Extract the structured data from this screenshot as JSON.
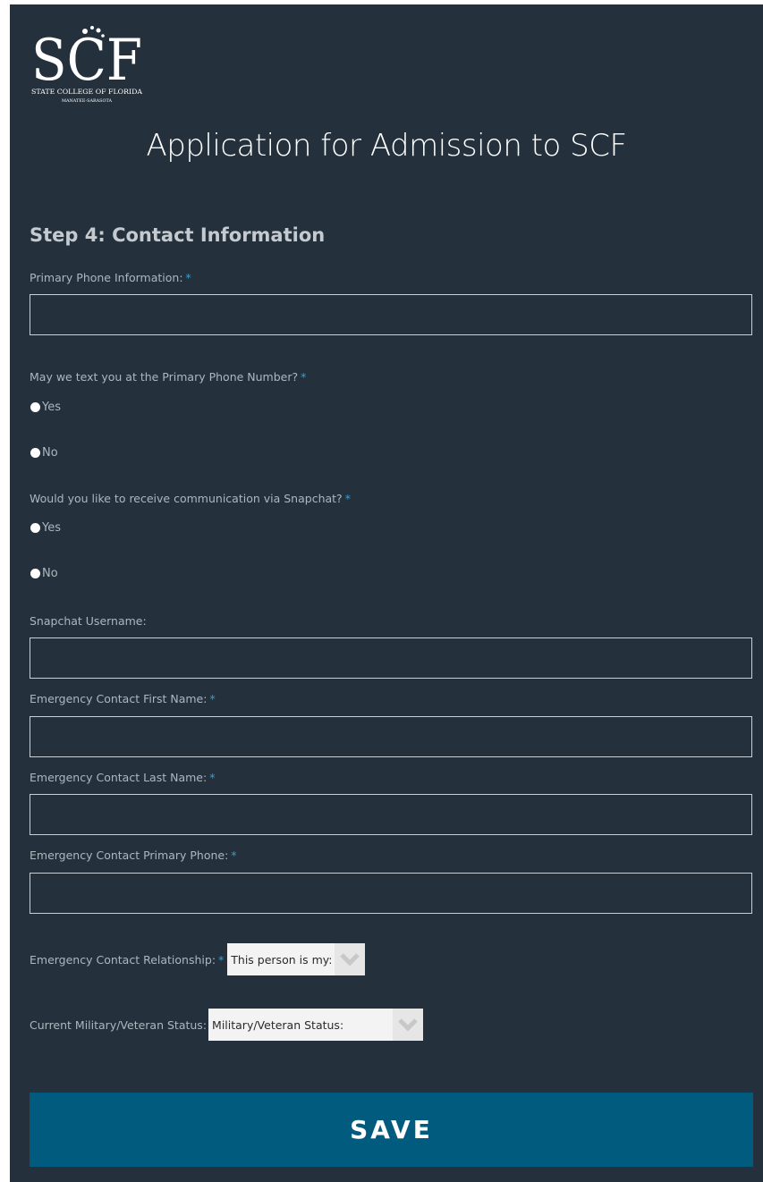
{
  "brand": {
    "logo_letters": "SCF",
    "logo_tagline": "STATE COLLEGE OF FLORIDA",
    "logo_subtagline": "MANATEE-SARASOTA"
  },
  "page": {
    "title": "Application for Admission to SCF",
    "step_heading": "Step 4: Contact Information"
  },
  "form": {
    "required_marker": "*",
    "primary_phone": {
      "label": "Primary Phone Information:",
      "value": ""
    },
    "text_permission": {
      "label": "May we text you at the Primary Phone Number?",
      "options": [
        "Yes",
        "No"
      ]
    },
    "snapchat_permission": {
      "label": "Would you like to receive communication via Snapchat?",
      "options": [
        "Yes",
        "No"
      ]
    },
    "snapchat_username": {
      "label": "Snapchat Username:",
      "value": ""
    },
    "emergency_first_name": {
      "label": "Emergency Contact First Name:",
      "value": ""
    },
    "emergency_last_name": {
      "label": "Emergency Contact Last Name:",
      "value": ""
    },
    "emergency_phone": {
      "label": "Emergency Contact Primary Phone:",
      "value": ""
    },
    "emergency_relationship": {
      "label": "Emergency Contact Relationship:",
      "selected": "This person is my:"
    },
    "military_status": {
      "label": "Current Military/Veteran Status:",
      "selected": "Military/Veteran Status:"
    },
    "save_label": "SAVE"
  },
  "icons": {
    "dropdown": "chevron-down-icon",
    "radio": "radio-icon"
  },
  "colors": {
    "panel_bg": "#24313d",
    "accent": "#2fa3d6",
    "button_bg": "#005b7f"
  }
}
